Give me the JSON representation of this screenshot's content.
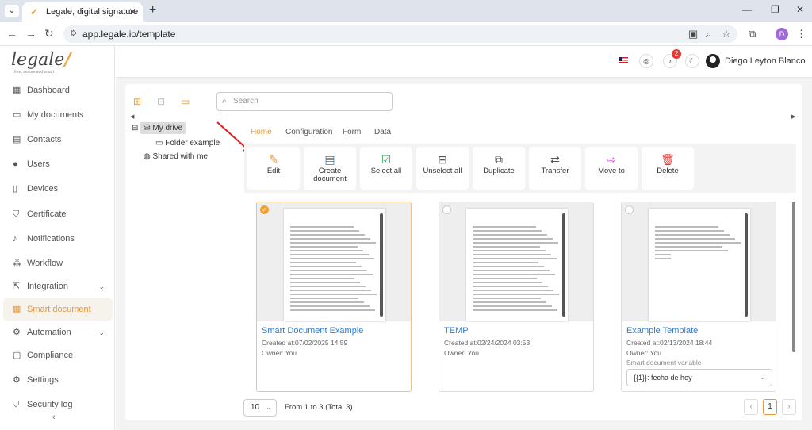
{
  "browser": {
    "tab_title": "Legale, digital signature",
    "url": "app.legale.io/template",
    "profile_initial": "D"
  },
  "brand": {
    "name": "legale",
    "tagline": "free, secure and smart"
  },
  "sidebar": {
    "items": [
      {
        "label": "Dashboard",
        "icon": "dashboard-icon"
      },
      {
        "label": "My documents",
        "icon": "folder-icon"
      },
      {
        "label": "Contacts",
        "icon": "contacts-icon"
      },
      {
        "label": "Users",
        "icon": "user-icon"
      },
      {
        "label": "Devices",
        "icon": "device-icon"
      },
      {
        "label": "Certificate",
        "icon": "shield-icon"
      },
      {
        "label": "Notifications",
        "icon": "bell-icon"
      },
      {
        "label": "Workflow",
        "icon": "workflow-icon"
      },
      {
        "label": "Integration",
        "icon": "integration-icon"
      },
      {
        "label": "Smart document",
        "icon": "table-icon"
      },
      {
        "label": "Automation",
        "icon": "gear-icon"
      },
      {
        "label": "Compliance",
        "icon": "chat-icon"
      },
      {
        "label": "Settings",
        "icon": "gear-icon"
      },
      {
        "label": "Security log",
        "icon": "shield-icon"
      }
    ]
  },
  "header": {
    "notification_count": "2",
    "user_name": "Diego Leyton Blanco"
  },
  "search": {
    "placeholder": "Search"
  },
  "tree": {
    "my_drive": "My drive",
    "folder": "Folder example",
    "shared": "Shared with me"
  },
  "subtabs": [
    "Home",
    "Configuration",
    "Form",
    "Data"
  ],
  "actions": [
    {
      "label": "Edit",
      "icon": "pencil-icon"
    },
    {
      "label": "Create document",
      "icon": "document-icon"
    },
    {
      "label": "Select all",
      "icon": "check-square-icon"
    },
    {
      "label": "Unselect all",
      "icon": "minus-square-icon"
    },
    {
      "label": "Duplicate",
      "icon": "copy-icon"
    },
    {
      "label": "Transfer",
      "icon": "transfer-icon"
    },
    {
      "label": "Move to",
      "icon": "folder-move-icon"
    },
    {
      "label": "Delete",
      "icon": "trash-icon"
    }
  ],
  "cards": [
    {
      "title": "Smart Document Example",
      "created": "Created at:07/02/2025 14:59",
      "owner": "Owner: You"
    },
    {
      "title": "TEMP",
      "created": "Created at:02/24/2024 03:53",
      "owner": "Owner: You"
    },
    {
      "title": "Example Template",
      "created": "Created at:02/13/2024 18:44",
      "owner": "Owner: You",
      "variable_label": "Smart document variable",
      "variable_value": "{{1}}: fecha de hoy"
    }
  ],
  "footer": {
    "page_size": "10",
    "range": "From 1 to 3 (Total 3)",
    "current_page": "1"
  },
  "colors": {
    "accent": "#e8973a",
    "link": "#2a7bd1",
    "badge": "#e53935"
  }
}
